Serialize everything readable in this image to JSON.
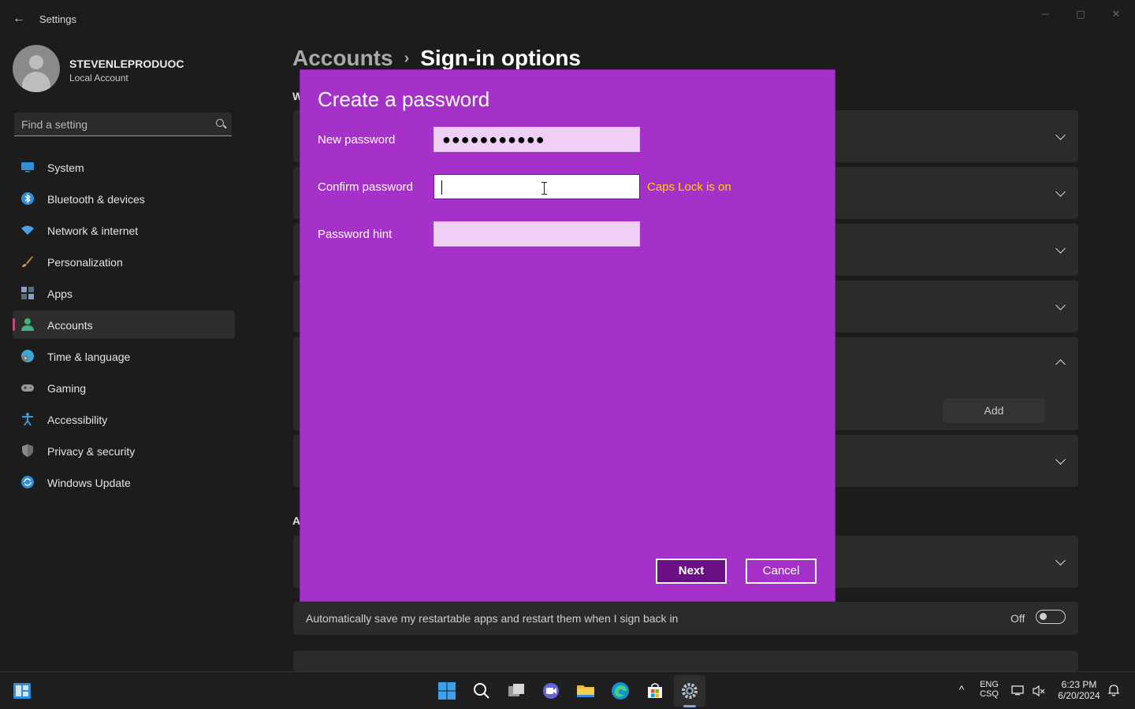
{
  "window": {
    "back_glyph": "←",
    "title": "Settings",
    "minimize_glyph": "─",
    "maximize_glyph": "▢",
    "close_glyph": "✕"
  },
  "profile": {
    "name": "STEVENLEPRODUOC",
    "account_type": "Local Account"
  },
  "search": {
    "placeholder": "Find a setting"
  },
  "sidebar": {
    "items": [
      {
        "label": "System",
        "icon": "system-icon",
        "color": "#2f8fd8"
      },
      {
        "label": "Bluetooth & devices",
        "icon": "bluetooth-icon",
        "color": "#2f8fd8"
      },
      {
        "label": "Network & internet",
        "icon": "wifi-icon",
        "color": "#4aa3e8"
      },
      {
        "label": "Personalization",
        "icon": "brush-icon",
        "color": "#d98a3a"
      },
      {
        "label": "Apps",
        "icon": "apps-icon",
        "color": "#8aa0c0"
      },
      {
        "label": "Accounts",
        "icon": "accounts-icon",
        "color": "#3fb27f",
        "active": true
      },
      {
        "label": "Time & language",
        "icon": "globe-clock-icon",
        "color": "#3ba8d8"
      },
      {
        "label": "Gaming",
        "icon": "gamepad-icon",
        "color": "#9a9a9a"
      },
      {
        "label": "Accessibility",
        "icon": "accessibility-icon",
        "color": "#3a9ad8"
      },
      {
        "label": "Privacy & security",
        "icon": "shield-icon",
        "color": "#8a8a8a"
      },
      {
        "label": "Windows Update",
        "icon": "update-icon",
        "color": "#2f8fd8"
      }
    ]
  },
  "main": {
    "breadcrumb_parent": "Accounts",
    "breadcrumb_sep": "›",
    "breadcrumb_current": "Sign-in options",
    "section_initial_1": "W",
    "section_initial_2": "A",
    "add_button": "Add",
    "restart_apps_text": "Automatically save my restartable apps and restart them when I sign back in",
    "restart_apps_state": "Off"
  },
  "dialog": {
    "title": "Create a password",
    "new_password_label": "New password",
    "new_password_value": "●●●●●●●●●●●",
    "confirm_password_label": "Confirm password",
    "confirm_password_value": "",
    "caps_lock_warning": "Caps Lock is on",
    "password_hint_label": "Password hint",
    "password_hint_value": "",
    "next_button": "Next",
    "cancel_button": "Cancel",
    "background_color": "#a531c8",
    "warning_color": "#ffd400"
  },
  "taskbar": {
    "language_top": "ENG",
    "language_bottom": "CSQ",
    "time": "6:23 PM",
    "date": "6/20/2024",
    "tray_chevron": "^"
  }
}
